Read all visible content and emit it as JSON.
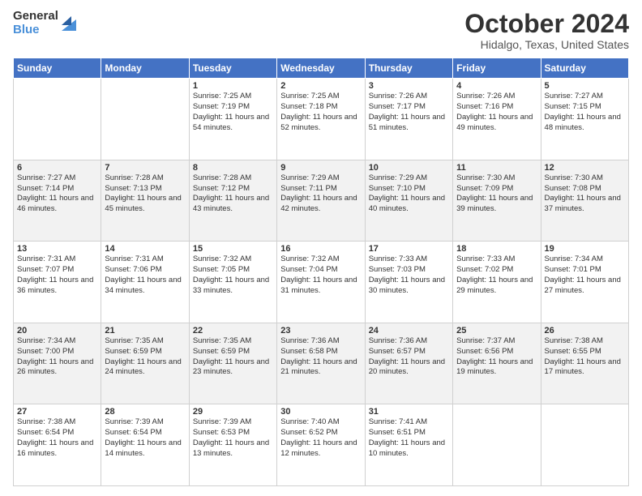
{
  "header": {
    "logo_general": "General",
    "logo_blue": "Blue",
    "month_title": "October 2024",
    "location": "Hidalgo, Texas, United States"
  },
  "days_of_week": [
    "Sunday",
    "Monday",
    "Tuesday",
    "Wednesday",
    "Thursday",
    "Friday",
    "Saturday"
  ],
  "weeks": [
    [
      {
        "day": "",
        "sunrise": "",
        "sunset": "",
        "daylight": ""
      },
      {
        "day": "",
        "sunrise": "",
        "sunset": "",
        "daylight": ""
      },
      {
        "day": "1",
        "sunrise": "Sunrise: 7:25 AM",
        "sunset": "Sunset: 7:19 PM",
        "daylight": "Daylight: 11 hours and 54 minutes."
      },
      {
        "day": "2",
        "sunrise": "Sunrise: 7:25 AM",
        "sunset": "Sunset: 7:18 PM",
        "daylight": "Daylight: 11 hours and 52 minutes."
      },
      {
        "day": "3",
        "sunrise": "Sunrise: 7:26 AM",
        "sunset": "Sunset: 7:17 PM",
        "daylight": "Daylight: 11 hours and 51 minutes."
      },
      {
        "day": "4",
        "sunrise": "Sunrise: 7:26 AM",
        "sunset": "Sunset: 7:16 PM",
        "daylight": "Daylight: 11 hours and 49 minutes."
      },
      {
        "day": "5",
        "sunrise": "Sunrise: 7:27 AM",
        "sunset": "Sunset: 7:15 PM",
        "daylight": "Daylight: 11 hours and 48 minutes."
      }
    ],
    [
      {
        "day": "6",
        "sunrise": "Sunrise: 7:27 AM",
        "sunset": "Sunset: 7:14 PM",
        "daylight": "Daylight: 11 hours and 46 minutes."
      },
      {
        "day": "7",
        "sunrise": "Sunrise: 7:28 AM",
        "sunset": "Sunset: 7:13 PM",
        "daylight": "Daylight: 11 hours and 45 minutes."
      },
      {
        "day": "8",
        "sunrise": "Sunrise: 7:28 AM",
        "sunset": "Sunset: 7:12 PM",
        "daylight": "Daylight: 11 hours and 43 minutes."
      },
      {
        "day": "9",
        "sunrise": "Sunrise: 7:29 AM",
        "sunset": "Sunset: 7:11 PM",
        "daylight": "Daylight: 11 hours and 42 minutes."
      },
      {
        "day": "10",
        "sunrise": "Sunrise: 7:29 AM",
        "sunset": "Sunset: 7:10 PM",
        "daylight": "Daylight: 11 hours and 40 minutes."
      },
      {
        "day": "11",
        "sunrise": "Sunrise: 7:30 AM",
        "sunset": "Sunset: 7:09 PM",
        "daylight": "Daylight: 11 hours and 39 minutes."
      },
      {
        "day": "12",
        "sunrise": "Sunrise: 7:30 AM",
        "sunset": "Sunset: 7:08 PM",
        "daylight": "Daylight: 11 hours and 37 minutes."
      }
    ],
    [
      {
        "day": "13",
        "sunrise": "Sunrise: 7:31 AM",
        "sunset": "Sunset: 7:07 PM",
        "daylight": "Daylight: 11 hours and 36 minutes."
      },
      {
        "day": "14",
        "sunrise": "Sunrise: 7:31 AM",
        "sunset": "Sunset: 7:06 PM",
        "daylight": "Daylight: 11 hours and 34 minutes."
      },
      {
        "day": "15",
        "sunrise": "Sunrise: 7:32 AM",
        "sunset": "Sunset: 7:05 PM",
        "daylight": "Daylight: 11 hours and 33 minutes."
      },
      {
        "day": "16",
        "sunrise": "Sunrise: 7:32 AM",
        "sunset": "Sunset: 7:04 PM",
        "daylight": "Daylight: 11 hours and 31 minutes."
      },
      {
        "day": "17",
        "sunrise": "Sunrise: 7:33 AM",
        "sunset": "Sunset: 7:03 PM",
        "daylight": "Daylight: 11 hours and 30 minutes."
      },
      {
        "day": "18",
        "sunrise": "Sunrise: 7:33 AM",
        "sunset": "Sunset: 7:02 PM",
        "daylight": "Daylight: 11 hours and 29 minutes."
      },
      {
        "day": "19",
        "sunrise": "Sunrise: 7:34 AM",
        "sunset": "Sunset: 7:01 PM",
        "daylight": "Daylight: 11 hours and 27 minutes."
      }
    ],
    [
      {
        "day": "20",
        "sunrise": "Sunrise: 7:34 AM",
        "sunset": "Sunset: 7:00 PM",
        "daylight": "Daylight: 11 hours and 26 minutes."
      },
      {
        "day": "21",
        "sunrise": "Sunrise: 7:35 AM",
        "sunset": "Sunset: 6:59 PM",
        "daylight": "Daylight: 11 hours and 24 minutes."
      },
      {
        "day": "22",
        "sunrise": "Sunrise: 7:35 AM",
        "sunset": "Sunset: 6:59 PM",
        "daylight": "Daylight: 11 hours and 23 minutes."
      },
      {
        "day": "23",
        "sunrise": "Sunrise: 7:36 AM",
        "sunset": "Sunset: 6:58 PM",
        "daylight": "Daylight: 11 hours and 21 minutes."
      },
      {
        "day": "24",
        "sunrise": "Sunrise: 7:36 AM",
        "sunset": "Sunset: 6:57 PM",
        "daylight": "Daylight: 11 hours and 20 minutes."
      },
      {
        "day": "25",
        "sunrise": "Sunrise: 7:37 AM",
        "sunset": "Sunset: 6:56 PM",
        "daylight": "Daylight: 11 hours and 19 minutes."
      },
      {
        "day": "26",
        "sunrise": "Sunrise: 7:38 AM",
        "sunset": "Sunset: 6:55 PM",
        "daylight": "Daylight: 11 hours and 17 minutes."
      }
    ],
    [
      {
        "day": "27",
        "sunrise": "Sunrise: 7:38 AM",
        "sunset": "Sunset: 6:54 PM",
        "daylight": "Daylight: 11 hours and 16 minutes."
      },
      {
        "day": "28",
        "sunrise": "Sunrise: 7:39 AM",
        "sunset": "Sunset: 6:54 PM",
        "daylight": "Daylight: 11 hours and 14 minutes."
      },
      {
        "day": "29",
        "sunrise": "Sunrise: 7:39 AM",
        "sunset": "Sunset: 6:53 PM",
        "daylight": "Daylight: 11 hours and 13 minutes."
      },
      {
        "day": "30",
        "sunrise": "Sunrise: 7:40 AM",
        "sunset": "Sunset: 6:52 PM",
        "daylight": "Daylight: 11 hours and 12 minutes."
      },
      {
        "day": "31",
        "sunrise": "Sunrise: 7:41 AM",
        "sunset": "Sunset: 6:51 PM",
        "daylight": "Daylight: 11 hours and 10 minutes."
      },
      {
        "day": "",
        "sunrise": "",
        "sunset": "",
        "daylight": ""
      },
      {
        "day": "",
        "sunrise": "",
        "sunset": "",
        "daylight": ""
      }
    ]
  ]
}
